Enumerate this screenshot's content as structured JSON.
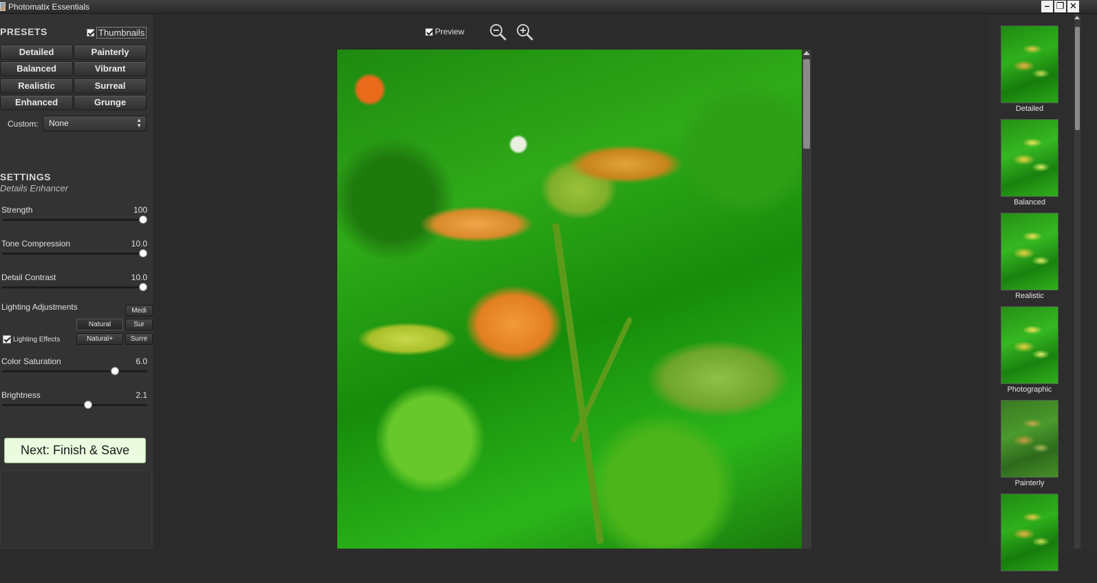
{
  "window": {
    "title": "Photomatix Essentials",
    "minimize": "–",
    "restore": "❐",
    "close": "✕"
  },
  "presets": {
    "title": "PRESETS",
    "thumbnails_label": "Thumbnails",
    "thumbnails_checked": true,
    "buttons": [
      "Detailed",
      "Painterly",
      "Balanced",
      "Vibrant",
      "Realistic",
      "Surreal",
      "Enhanced",
      "Grunge"
    ],
    "custom_label": "Custom:",
    "custom_value": "None"
  },
  "settings": {
    "title": "SETTINGS",
    "subtitle": "Details Enhancer",
    "sliders": [
      {
        "label": "Strength",
        "value": "100",
        "fraction": 1.0
      },
      {
        "label": "Tone Compression",
        "value": "10.0",
        "fraction": 1.0
      },
      {
        "label": "Detail Contrast",
        "value": "10.0",
        "fraction": 1.0
      }
    ],
    "lighting": {
      "title": "Lighting Adjustments",
      "buttons": [
        "Medi",
        "Natural",
        "Sur",
        "Natural+",
        "Surre"
      ],
      "effects_label": "Lighting Effects",
      "effects_checked": true
    },
    "sliders2": [
      {
        "label": "Color Saturation",
        "value": "6.0",
        "fraction": 0.8
      },
      {
        "label": "Brightness",
        "value": "2.1",
        "fraction": 0.6
      }
    ]
  },
  "next_button": "Next: Finish & Save",
  "preview": {
    "label": "Preview",
    "checked": true
  },
  "thumbnails": [
    "Detailed",
    "Balanced",
    "Realistic",
    "Photographic",
    "Painterly"
  ]
}
